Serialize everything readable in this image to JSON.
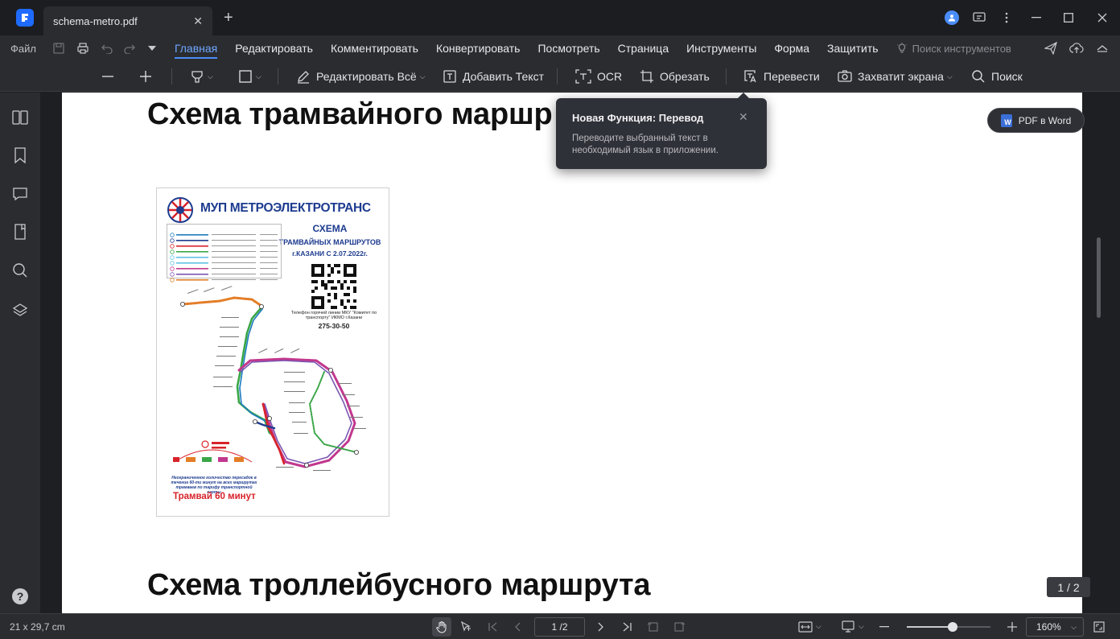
{
  "window": {
    "tab_title": "schema-metro.pdf",
    "tab_close": "✕",
    "new_tab": "+"
  },
  "menubar": {
    "file_label": "Файл",
    "items": [
      "Главная",
      "Редактировать",
      "Комментировать",
      "Конвертировать",
      "Посмотреть",
      "Страница",
      "Инструменты",
      "Форма",
      "Защитить"
    ],
    "active_item": "Главная",
    "tool_search_placeholder": "Поиск инструментов"
  },
  "toolbar": {
    "edit_all": "Редактировать Всё",
    "add_text": "Добавить Текст",
    "ocr": "OCR",
    "crop": "Обрезать",
    "translate": "Перевести",
    "screenshot": "Захватит экрана",
    "search": "Поиск"
  },
  "left_rail": {
    "icons": [
      "panels-icon",
      "bookmark-icon",
      "comment-icon",
      "attachment-icon",
      "search-icon",
      "layers-icon"
    ],
    "help": "?"
  },
  "document": {
    "heading_1": "Схема трамвайного маршр",
    "heading_2": "Схема троллейбусного маршрута",
    "pdf_to_word": "PDF в Word",
    "page_badge": "1 / 2",
    "scheme_image": {
      "org": "МУП МЕТРОЭЛЕКТРОТРАНС",
      "title": "СХЕМА",
      "subtitle": "ТРАМВАЙНЫХ МАРШРУТОВ",
      "date_line": "г.КАЗАНИ С 2.07.2022г.",
      "phone_caption": "Телефон горячей линии МКУ \"Комитет по транспорту\" ИКМО г.Казани",
      "phone": "275-30-50",
      "promo": "Трамвай 60 минут",
      "note": "Неограниченное количество пересадок в течение 60-ти минут на всех маршрутах трамваев по тарифу транспортной карты",
      "lines": [
        {
          "num": "1",
          "color": "#1a7bbf"
        },
        {
          "num": "2",
          "color": "#1d3b8f"
        },
        {
          "num": "3",
          "color": "#d8232a"
        },
        {
          "num": "4",
          "color": "#3aa648"
        },
        {
          "num": "5",
          "color": "#5fc2e4"
        },
        {
          "num": "6",
          "color": "#c2378e"
        },
        {
          "num": "7",
          "color": "#7a56b2"
        },
        {
          "num": "8",
          "color": "#e37d27"
        },
        {
          "num": "9",
          "color": "#8a5a2b"
        }
      ]
    }
  },
  "tooltip": {
    "title": "Новая Функция: Перевод",
    "body": "Переводите выбранный текст в необходимый язык в приложении.",
    "close": "✕"
  },
  "statusbar": {
    "page_size": "21 x 29,7 cm",
    "page_indicator": "1 /2",
    "zoom": "160%",
    "zoom_slider_fraction": 0.55
  },
  "colors": {
    "accent": "#4a8df8",
    "app_bg": "#1e1f22",
    "panel_bg": "#2b2c30"
  }
}
